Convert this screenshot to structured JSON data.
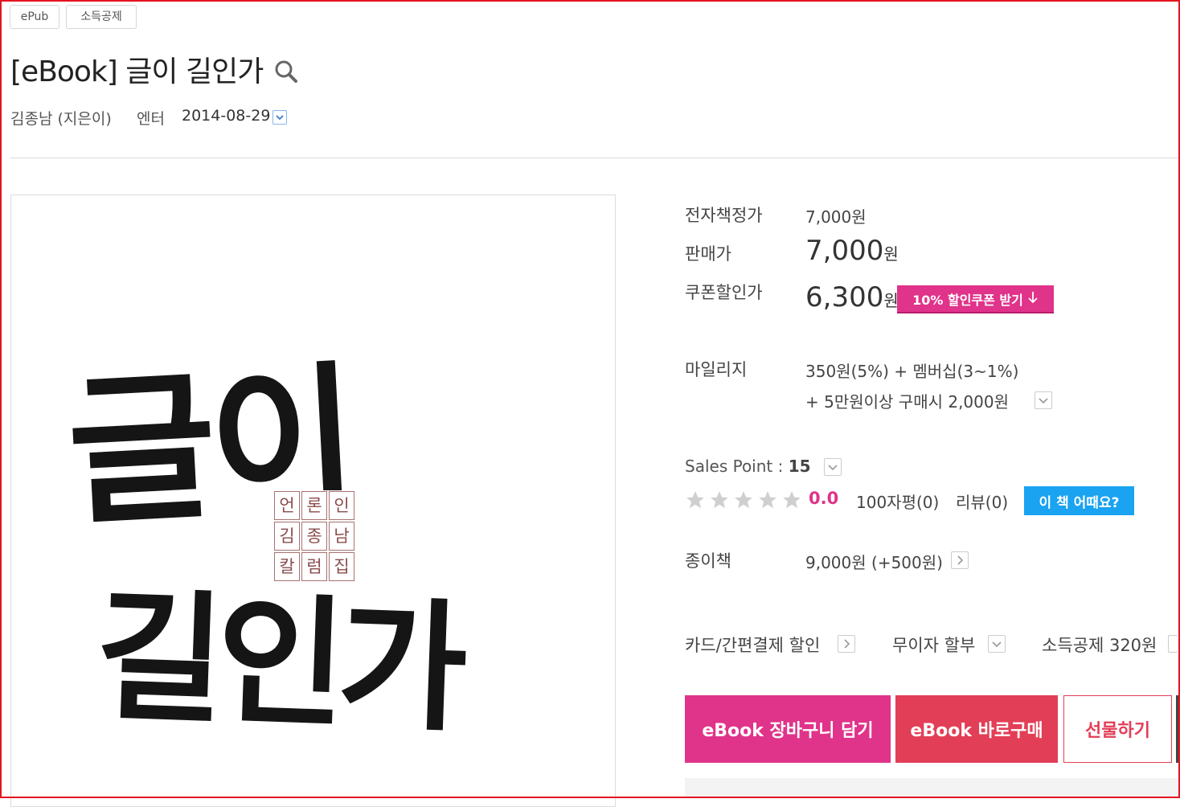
{
  "tags": [
    "ePub",
    "소득공제"
  ],
  "title": "[eBook] 글이 길인가",
  "author": "김종남 (지은이)",
  "publisher": "엔터",
  "date": "2014-08-29",
  "cover": {
    "big_text_1": "글이",
    "big_text_2": "길인가",
    "stamp_rows": [
      [
        "언",
        "론",
        "인"
      ],
      [
        "김",
        "종",
        "남"
      ],
      [
        "칼",
        "럼",
        "집"
      ]
    ]
  },
  "price": {
    "list_label": "전자책정가",
    "list_value": "7,000원",
    "sale_label": "판매가",
    "sale_value": "7,000",
    "sale_unit": "원",
    "coupon_label": "쿠폰할인가",
    "coupon_value": "6,300",
    "coupon_unit": "원",
    "coupon_button": "10% 할인쿠폰 받기"
  },
  "mileage": {
    "label": "마일리지",
    "line1": "350원(5%) + 멤버십(3~1%)",
    "line2": "+ 5만원이상 구매시 2,000원"
  },
  "sales": {
    "label": "Sales Point : ",
    "value": "15",
    "rating": "0.0",
    "stars": 0,
    "reviews100": "100자평(0)",
    "reviews": "리뷰(0)",
    "ask_button": "이 책 어때요?"
  },
  "paper": {
    "label": "종이책",
    "value": "9,000원 (+500원)"
  },
  "options": {
    "card": "카드/간편결제 할인",
    "installment": "무이자 할부",
    "deduction": "소득공제 320원"
  },
  "buttons": {
    "cart": "eBook 장바구니 담기",
    "buy": "eBook 바로구매",
    "gift": "선물하기"
  },
  "colors": {
    "pink": "#e0338a",
    "red": "#e33e57",
    "blue": "#19a3f1",
    "frame": "#e5141f"
  }
}
